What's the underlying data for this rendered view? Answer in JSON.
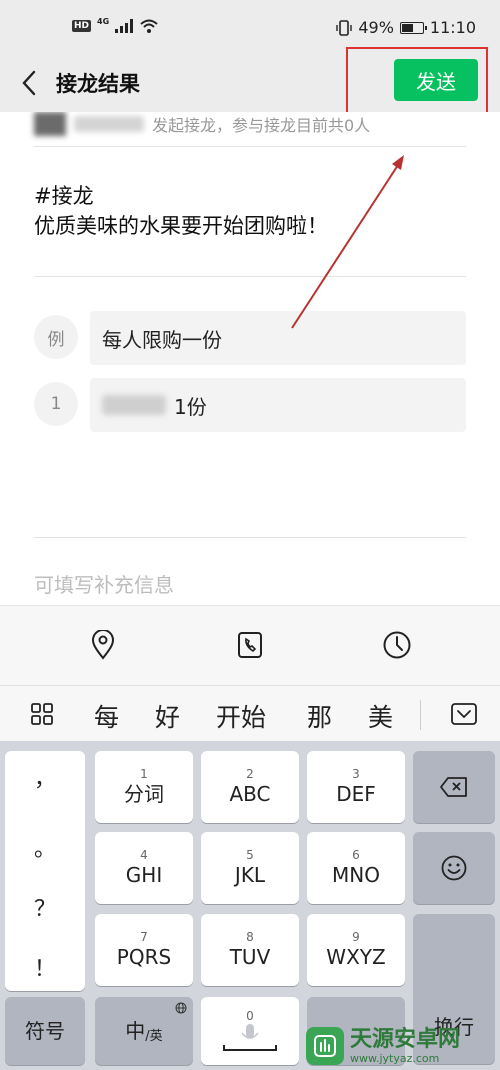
{
  "status_bar": {
    "hd": "HD",
    "network": "4G",
    "battery": "49%",
    "battery_level": 0.49,
    "time": "11:10"
  },
  "nav": {
    "title": "接龙结果",
    "send_label": "发送"
  },
  "content": {
    "creator_text": "发起接龙，参与接龙目前共0人",
    "topic_tag": "#接龙",
    "topic_desc": "优质美味的水果要开始团购啦！",
    "entries": [
      {
        "index": "例",
        "text": "每人限购一份"
      },
      {
        "index": "1",
        "text": "1份"
      }
    ],
    "supplement_placeholder": "可填写补充信息"
  },
  "toolbar": {
    "icons": [
      "location-icon",
      "phone-icon",
      "clock-icon"
    ]
  },
  "candidates": {
    "items": [
      "每",
      "好",
      "开始",
      "那",
      "美"
    ]
  },
  "keyboard": {
    "punctuation": [
      "，",
      "。",
      "？",
      "！"
    ],
    "rows": [
      [
        {
          "num": "1",
          "label": "分词"
        },
        {
          "num": "2",
          "label": "ABC"
        },
        {
          "num": "3",
          "label": "DEF"
        }
      ],
      [
        {
          "num": "4",
          "label": "GHI"
        },
        {
          "num": "5",
          "label": "JKL"
        },
        {
          "num": "6",
          "label": "MNO"
        }
      ],
      [
        {
          "num": "7",
          "label": "PQRS"
        },
        {
          "num": "8",
          "label": "TUV"
        },
        {
          "num": "9",
          "label": "WXYZ"
        }
      ]
    ],
    "symbol_label": "符号",
    "lang_label": "中",
    "lang_sub": "/英",
    "zero_num": "0",
    "enter_label": "换行"
  },
  "watermark": {
    "title": "天源安卓网",
    "url": "www.jytyaz.com"
  },
  "colors": {
    "accent_green": "#07c160",
    "highlight_red": "#d33333"
  }
}
